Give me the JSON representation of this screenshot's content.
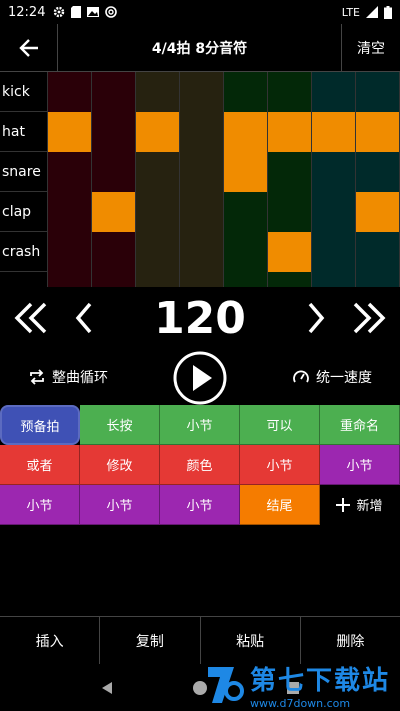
{
  "statusbar": {
    "time": "12:24",
    "network": "LTE"
  },
  "header": {
    "title": "4/4拍 8分音符",
    "clear": "清空"
  },
  "grid": {
    "rows": [
      {
        "label": "kick",
        "cells": [
          0,
          0,
          0,
          0,
          0,
          0,
          0,
          0
        ]
      },
      {
        "label": "hat",
        "cells": [
          1,
          0,
          1,
          0,
          1,
          1,
          1,
          1
        ]
      },
      {
        "label": "snare",
        "cells": [
          0,
          0,
          0,
          0,
          1,
          0,
          0,
          0
        ]
      },
      {
        "label": "clap",
        "cells": [
          0,
          1,
          0,
          0,
          0,
          0,
          0,
          1
        ]
      },
      {
        "label": "crash",
        "cells": [
          0,
          0,
          0,
          0,
          0,
          1,
          0,
          0
        ]
      },
      {
        "label": "",
        "cells": [
          0,
          0,
          0,
          0,
          0,
          0,
          0,
          0
        ]
      }
    ],
    "column_colors": [
      "#2a0008",
      "#2a0008",
      "#262210",
      "#262210",
      "#032808",
      "#032808",
      "#002a2a",
      "#002a2a"
    ],
    "active_color": "#f08c00"
  },
  "tempo": {
    "bpm": "120"
  },
  "controls": {
    "loop": "整曲循环",
    "speed": "统一速度"
  },
  "patterns": [
    [
      {
        "label": "预备拍",
        "color": "selected"
      },
      {
        "label": "长按",
        "color": "green"
      },
      {
        "label": "小节",
        "color": "green"
      },
      {
        "label": "可以",
        "color": "green"
      },
      {
        "label": "重命名",
        "color": "green"
      }
    ],
    [
      {
        "label": "或者",
        "color": "red"
      },
      {
        "label": "修改",
        "color": "red"
      },
      {
        "label": "颜色",
        "color": "red"
      },
      {
        "label": "小节",
        "color": "red"
      },
      {
        "label": "小节",
        "color": "purple"
      }
    ],
    [
      {
        "label": "小节",
        "color": "purple"
      },
      {
        "label": "小节",
        "color": "purple"
      },
      {
        "label": "小节",
        "color": "purple"
      },
      {
        "label": "结尾",
        "color": "orange"
      },
      {
        "label": "新增",
        "color": "black"
      }
    ]
  ],
  "editbar": {
    "insert": "插入",
    "copy": "复制",
    "paste": "粘贴",
    "delete": "删除"
  },
  "watermark": {
    "main": "第七下载站",
    "url": "www.d7down.com"
  }
}
